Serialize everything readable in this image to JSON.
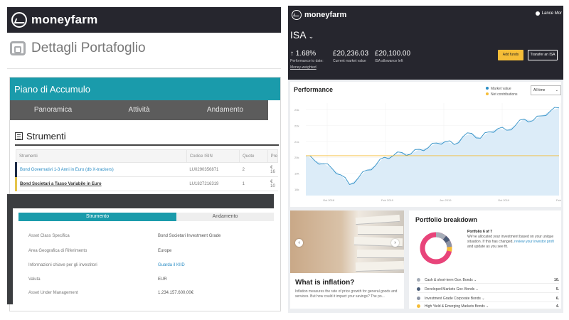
{
  "left": {
    "brand": "moneyfarm",
    "page_title": "Dettagli Portafoglio",
    "plan_title": "Piano di Accumulo",
    "tabs": [
      "Panoramica",
      "Attività",
      "Andamento"
    ],
    "section_title": "Strumenti",
    "table": {
      "headers": [
        "Strumenti",
        "Codice ISIN",
        "Quote",
        "Pre"
      ],
      "rows": [
        {
          "name": "Bond Governativi 1-3 Anni in Euro (db X-trackers)",
          "isin": "LU0290356871",
          "quote": "2",
          "price": "€ 16"
        },
        {
          "name": "Bond Societari a Tasso Variabile in Euro",
          "isin": "LU1827216319",
          "quote": "1",
          "price": "€ 10"
        }
      ]
    },
    "detail_tabs": [
      "Strumento",
      "Andamento"
    ],
    "details": [
      {
        "k": "Asset Class Specifica",
        "v": "Bond Societari Investment Grade"
      },
      {
        "k": "Area Geografica di Riferimento",
        "v": "Europe"
      },
      {
        "k": "Informazioni chiave per gli investitori",
        "v": "Guarda il KIID"
      },
      {
        "k": "Valuta",
        "v": "EUR"
      },
      {
        "k": "Asset Under Management",
        "v": "1.234.157.600,00€"
      }
    ],
    "colors": {
      "teal": "#1a9bab",
      "dark": "#26262e"
    }
  },
  "right": {
    "brand": "moneyfarm",
    "user": "Lance Mor",
    "account": "ISA",
    "stats": [
      {
        "big": "↑ 1.68%",
        "small": "Performance to date:",
        "small2": "Money-weighted"
      },
      {
        "big": "£20,236.03",
        "small": "Current market value",
        "small2": ""
      },
      {
        "big": "£20,100.00",
        "small": "ISA allowance left",
        "small2": ""
      }
    ],
    "add_funds": "Add funds",
    "transfer": "Transfer an ISA",
    "performance": {
      "title": "Performance",
      "legend": [
        "Market value",
        "Net contributions"
      ],
      "range": "All time"
    },
    "chart_data": {
      "type": "area",
      "title": "Performance",
      "yticks": [
        "23k",
        "22k",
        "21k",
        "20k",
        "19k",
        "18k"
      ],
      "xticks": [
        "Oct 2018",
        "Feb 2019",
        "Jun 2019",
        "Oct 2019",
        "Feb 2020"
      ],
      "series": [
        {
          "name": "Market value",
          "values": [
            20.1,
            19.8,
            19.6,
            19.3,
            18.9,
            18.3,
            18.7,
            19.2,
            19.5,
            20.0,
            20.1,
            20.3,
            20.2,
            20.5,
            20.6,
            20.9,
            21.0,
            20.8,
            21.3,
            21.5,
            21.2,
            21.6,
            21.8,
            21.7,
            22.0,
            22.4,
            22.3,
            22.6,
            22.9,
            23.1
          ]
        },
        {
          "name": "Net contributions",
          "values": [
            20.1,
            20.1,
            20.1,
            20.1,
            20.1,
            20.1,
            20.1,
            20.1,
            20.1,
            20.1,
            20.1,
            20.1,
            20.1,
            20.1,
            20.1,
            20.1,
            20.1,
            20.1,
            20.1,
            20.1,
            20.1,
            20.1,
            20.1,
            20.1,
            20.1,
            20.1,
            20.1,
            20.1,
            20.1,
            20.1
          ]
        }
      ],
      "ylim": [
        17.6,
        23.4
      ]
    },
    "inflation": {
      "title": "What is inflation?",
      "text": "Inflation measures the rate of price growth for general goods and services. But how could it impact your savings? The po..."
    },
    "breakdown": {
      "title": "Portfolio breakdown",
      "portfolio": "Portfolio 6 of 7",
      "text_pre": "We've allocated your investment based on your unique situation. If this has changed,",
      "link": "review your investor profi",
      "text_post": "and update as you see fit.",
      "items": [
        {
          "name": "Cash & short-term Gov. Bonds",
          "pct": "10.",
          "color": "#a6adb8"
        },
        {
          "name": "Developed Markets Gov. Bonds",
          "pct": "5.",
          "color": "#4b5d78"
        },
        {
          "name": "Investment Grade Corporate Bonds",
          "pct": "6.",
          "color": "#8c94a4"
        },
        {
          "name": "High Yield & Emerging Markets Bonds",
          "pct": "4.",
          "color": "#f5bd37"
        }
      ]
    }
  }
}
